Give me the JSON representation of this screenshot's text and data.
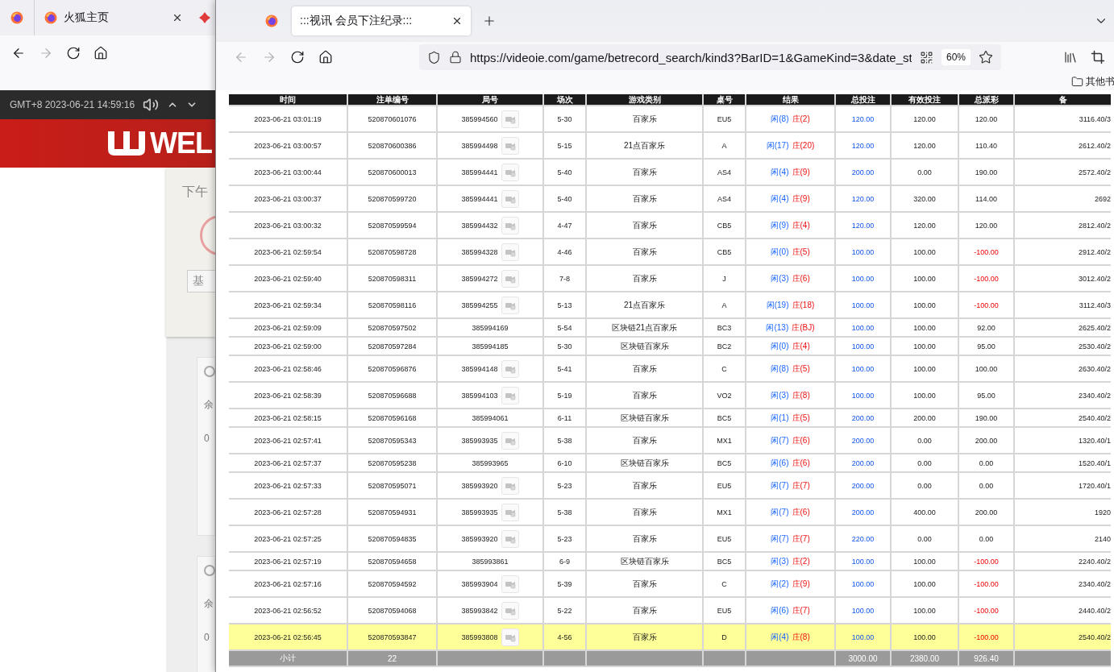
{
  "back_window": {
    "tabs": [
      {
        "label": "火狐主页",
        "selected": true
      }
    ],
    "nav": {
      "back_disabled": false,
      "forward_disabled": true
    },
    "clock": "GMT+8 2023-06-21 14:59:16",
    "logo_text": "WEL",
    "greeting": "下午",
    "button": "基",
    "cards": [
      {
        "label": "余",
        "value": "0"
      },
      {
        "label": "余",
        "value": "0"
      }
    ]
  },
  "window": {
    "tab": {
      "title": ":::视讯 会员下注纪录:::",
      "selected": true
    },
    "nav": {
      "back_disabled": true,
      "forward_disabled": true
    },
    "url": "https://videoie.com/game/betrecord_search/kind3?BarID=1&GameKind=3&date_st",
    "zoom": "60%",
    "bookmark_folder": "其他书"
  },
  "table": {
    "columns": [
      "时间",
      "注单编号",
      "局号",
      "场次",
      "游戏类别",
      "桌号",
      "结果",
      "总投注",
      "有效投注",
      "总派彩",
      "备"
    ],
    "rows": [
      {
        "time": "2023-06-21 03:01:19",
        "bet_no": "520870601076",
        "round_no": "385994560",
        "replay": true,
        "game_no": "5-30",
        "game_type": "百家乐",
        "table": "EU5",
        "player": "闲(8)",
        "banker": "庄(2)",
        "total_bet": "120.00",
        "valid_bet": "120.00",
        "payout": "120.00",
        "loss": false,
        "balance": "3116.40/3",
        "selected": false
      },
      {
        "time": "2023-06-21 03:00:57",
        "bet_no": "520870600386",
        "round_no": "385994498",
        "replay": true,
        "game_no": "5-15",
        "game_type": "21点百家乐",
        "table": "A",
        "player": "闲(17)",
        "banker": "庄(20)",
        "total_bet": "120.00",
        "valid_bet": "120.00",
        "payout": "110.40",
        "loss": false,
        "balance": "2612.40/2",
        "selected": false
      },
      {
        "time": "2023-06-21 03:00:44",
        "bet_no": "520870600013",
        "round_no": "385994441",
        "replay": true,
        "game_no": "5-40",
        "game_type": "百家乐",
        "table": "AS4",
        "player": "闲(4)",
        "banker": "庄(9)",
        "total_bet": "200.00",
        "valid_bet": "0.00",
        "payout": "190.00",
        "loss": false,
        "balance": "2572.40/2",
        "selected": false
      },
      {
        "time": "2023-06-21 03:00:37",
        "bet_no": "520870599720",
        "round_no": "385994441",
        "replay": true,
        "game_no": "5-40",
        "game_type": "百家乐",
        "table": "AS4",
        "player": "闲(4)",
        "banker": "庄(9)",
        "total_bet": "120.00",
        "valid_bet": "320.00",
        "payout": "114.00",
        "loss": false,
        "balance": "2692",
        "selected": false
      },
      {
        "time": "2023-06-21 03:00:32",
        "bet_no": "520870599594",
        "round_no": "385994432",
        "replay": true,
        "game_no": "4-47",
        "game_type": "百家乐",
        "table": "CB5",
        "player": "闲(9)",
        "banker": "庄(4)",
        "total_bet": "120.00",
        "valid_bet": "120.00",
        "payout": "120.00",
        "loss": false,
        "balance": "2812.40/2",
        "selected": false
      },
      {
        "time": "2023-06-21 02:59:54",
        "bet_no": "520870598728",
        "round_no": "385994328",
        "replay": true,
        "game_no": "4-46",
        "game_type": "百家乐",
        "table": "CB5",
        "player": "闲(0)",
        "banker": "庄(5)",
        "total_bet": "100.00",
        "valid_bet": "100.00",
        "payout": "-100.00",
        "loss": true,
        "balance": "2912.40/2",
        "selected": false
      },
      {
        "time": "2023-06-21 02:59:40",
        "bet_no": "520870598311",
        "round_no": "385994272",
        "replay": true,
        "game_no": "7-8",
        "game_type": "百家乐",
        "table": "J",
        "player": "闲(3)",
        "banker": "庄(6)",
        "total_bet": "100.00",
        "valid_bet": "100.00",
        "payout": "-100.00",
        "loss": true,
        "balance": "3012.40/2",
        "selected": false
      },
      {
        "time": "2023-06-21 02:59:34",
        "bet_no": "520870598116",
        "round_no": "385994255",
        "replay": true,
        "game_no": "5-13",
        "game_type": "21点百家乐",
        "table": "A",
        "player": "闲(19)",
        "banker": "庄(18)",
        "total_bet": "100.00",
        "valid_bet": "100.00",
        "payout": "-100.00",
        "loss": true,
        "balance": "3112.40/3",
        "selected": false
      },
      {
        "time": "2023-06-21 02:59:09",
        "bet_no": "520870597502",
        "round_no": "385994169",
        "replay": false,
        "game_no": "5-54",
        "game_type": "区块链21点百家乐",
        "table": "BC3",
        "player": "闲(13)",
        "banker": "庄(BJ)",
        "total_bet": "100.00",
        "valid_bet": "100.00",
        "payout": "92.00",
        "loss": false,
        "balance": "2625.40/2",
        "selected": false
      },
      {
        "time": "2023-06-21 02:59:00",
        "bet_no": "520870597284",
        "round_no": "385994185",
        "replay": false,
        "game_no": "5-30",
        "game_type": "区块链百家乐",
        "table": "BC2",
        "player": "闲(0)",
        "banker": "庄(4)",
        "total_bet": "100.00",
        "valid_bet": "100.00",
        "payout": "95.00",
        "loss": false,
        "balance": "2530.40/2",
        "selected": false
      },
      {
        "time": "2023-06-21 02:58:46",
        "bet_no": "520870596876",
        "round_no": "385994148",
        "replay": true,
        "game_no": "5-41",
        "game_type": "百家乐",
        "table": "C",
        "player": "闲(8)",
        "banker": "庄(5)",
        "total_bet": "100.00",
        "valid_bet": "100.00",
        "payout": "100.00",
        "loss": false,
        "balance": "2630.40/2",
        "selected": false
      },
      {
        "time": "2023-06-21 02:58:39",
        "bet_no": "520870596688",
        "round_no": "385994103",
        "replay": true,
        "game_no": "5-19",
        "game_type": "百家乐",
        "table": "VO2",
        "player": "闲(3)",
        "banker": "庄(8)",
        "total_bet": "100.00",
        "valid_bet": "100.00",
        "payout": "95.00",
        "loss": false,
        "balance": "2340.40/2",
        "selected": false
      },
      {
        "time": "2023-06-21 02:58:15",
        "bet_no": "520870596168",
        "round_no": "385994061",
        "replay": false,
        "game_no": "6-11",
        "game_type": "区块链百家乐",
        "table": "BC5",
        "player": "闲(1)",
        "banker": "庄(5)",
        "total_bet": "200.00",
        "valid_bet": "200.00",
        "payout": "190.00",
        "loss": false,
        "balance": "2540.40/2",
        "selected": false
      },
      {
        "time": "2023-06-21 02:57:41",
        "bet_no": "520870595343",
        "round_no": "385993935",
        "replay": true,
        "game_no": "5-38",
        "game_type": "百家乐",
        "table": "MX1",
        "player": "闲(7)",
        "banker": "庄(6)",
        "total_bet": "200.00",
        "valid_bet": "0.00",
        "payout": "200.00",
        "loss": false,
        "balance": "1320.40/1",
        "selected": false
      },
      {
        "time": "2023-06-21 02:57:37",
        "bet_no": "520870595238",
        "round_no": "385993965",
        "replay": false,
        "game_no": "6-10",
        "game_type": "区块链百家乐",
        "table": "BC5",
        "player": "闲(6)",
        "banker": "庄(6)",
        "total_bet": "200.00",
        "valid_bet": "0.00",
        "payout": "0.00",
        "loss": false,
        "balance": "1520.40/1",
        "selected": false
      },
      {
        "time": "2023-06-21 02:57:33",
        "bet_no": "520870595071",
        "round_no": "385993920",
        "replay": true,
        "game_no": "5-23",
        "game_type": "百家乐",
        "table": "EU5",
        "player": "闲(7)",
        "banker": "庄(7)",
        "total_bet": "200.00",
        "valid_bet": "0.00",
        "payout": "0.00",
        "loss": false,
        "balance": "1720.40/1",
        "selected": false
      },
      {
        "time": "2023-06-21 02:57:28",
        "bet_no": "520870594931",
        "round_no": "385993935",
        "replay": true,
        "game_no": "5-38",
        "game_type": "百家乐",
        "table": "MX1",
        "player": "闲(7)",
        "banker": "庄(6)",
        "total_bet": "200.00",
        "valid_bet": "400.00",
        "payout": "200.00",
        "loss": false,
        "balance": "1920",
        "selected": false
      },
      {
        "time": "2023-06-21 02:57:25",
        "bet_no": "520870594835",
        "round_no": "385993920",
        "replay": true,
        "game_no": "5-23",
        "game_type": "百家乐",
        "table": "EU5",
        "player": "闲(7)",
        "banker": "庄(7)",
        "total_bet": "220.00",
        "valid_bet": "0.00",
        "payout": "0.00",
        "loss": false,
        "balance": "2140",
        "selected": false
      },
      {
        "time": "2023-06-21 02:57:19",
        "bet_no": "520870594658",
        "round_no": "385993861",
        "replay": false,
        "game_no": "6-9",
        "game_type": "区块链百家乐",
        "table": "BC5",
        "player": "闲(3)",
        "banker": "庄(2)",
        "total_bet": "100.00",
        "valid_bet": "100.00",
        "payout": "-100.00",
        "loss": true,
        "balance": "2240.40/2",
        "selected": false
      },
      {
        "time": "2023-06-21 02:57:16",
        "bet_no": "520870594592",
        "round_no": "385993904",
        "replay": true,
        "game_no": "5-39",
        "game_type": "百家乐",
        "table": "C",
        "player": "闲(2)",
        "banker": "庄(9)",
        "total_bet": "100.00",
        "valid_bet": "100.00",
        "payout": "-100.00",
        "loss": true,
        "balance": "2340.40/2",
        "selected": false
      },
      {
        "time": "2023-06-21 02:56:52",
        "bet_no": "520870594068",
        "round_no": "385993842",
        "replay": true,
        "game_no": "5-22",
        "game_type": "百家乐",
        "table": "EU5",
        "player": "闲(6)",
        "banker": "庄(7)",
        "total_bet": "100.00",
        "valid_bet": "100.00",
        "payout": "-100.00",
        "loss": true,
        "balance": "2440.40/2",
        "selected": false
      },
      {
        "time": "2023-06-21 02:56:45",
        "bet_no": "520870593847",
        "round_no": "385993808",
        "replay": true,
        "game_no": "4-56",
        "game_type": "百家乐",
        "table": "D",
        "player": "闲(4)",
        "banker": "庄(8)",
        "total_bet": "100.00",
        "valid_bet": "100.00",
        "payout": "-100.00",
        "loss": true,
        "balance": "2540.40/2",
        "selected": true
      }
    ],
    "subtotal": {
      "label": "小计",
      "count": "22",
      "total_bet": "3000.00",
      "valid_bet": "2380.00",
      "payout": "926.40"
    }
  }
}
